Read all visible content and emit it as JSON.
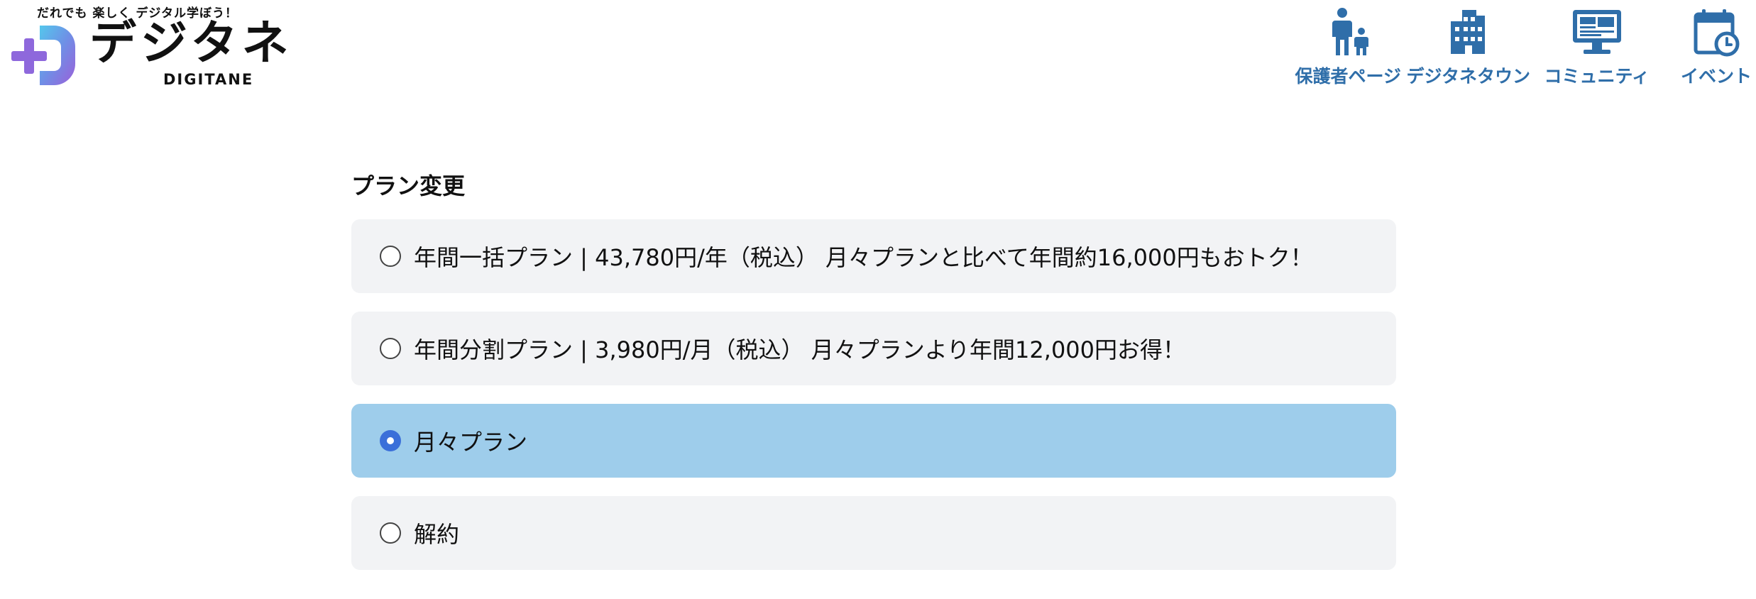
{
  "header": {
    "logo": {
      "tagline": "だれでも 楽しく デジタル学ぼう！",
      "name_jp": "デジタネ",
      "name_en": "DIGITANE"
    },
    "nav": [
      {
        "label": "保護者ページ",
        "icon": "parent-child-icon"
      },
      {
        "label": "デジタネタウン",
        "icon": "building-icon"
      },
      {
        "label": "コミュニティ",
        "icon": "monitor-icon"
      },
      {
        "label": "イベント",
        "icon": "calendar-clock-icon"
      }
    ]
  },
  "main": {
    "title": "プラン変更",
    "selected_index": 2,
    "options": [
      {
        "label": "年間一括プラン | 43,780円/年（税込） 月々プランと比べて年間約16,000円もおトク！"
      },
      {
        "label": "年間分割プラン | 3,980円/月（税込） 月々プランより年間12,000円お得！"
      },
      {
        "label": "月々プラン"
      },
      {
        "label": "解約"
      }
    ]
  },
  "colors": {
    "nav_text": "#2f6ea9",
    "option_background": "#f2f3f5",
    "option_selected_background": "#9ecdeb",
    "radio_selected": "#3b6fd9"
  }
}
